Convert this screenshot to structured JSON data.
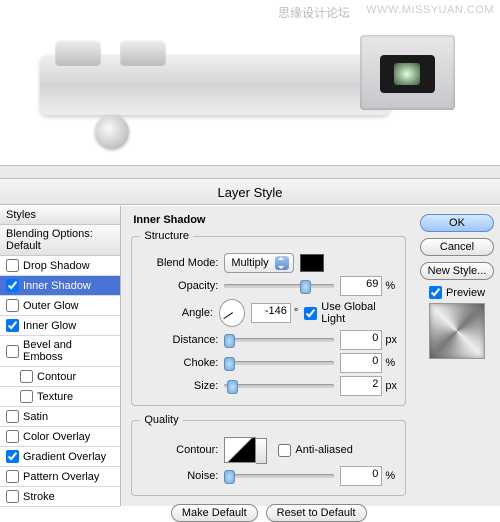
{
  "header": {
    "watermark_cn": "思缘设计论坛",
    "watermark_url": "WWW.MISSYUAN.COM"
  },
  "dialog": {
    "title": "Layer Style"
  },
  "left": {
    "styles_header": "Styles",
    "blending_header": "Blending Options: Default",
    "items": [
      "Drop Shadow",
      "Inner Shadow",
      "Outer Glow",
      "Inner Glow",
      "Bevel and Emboss",
      "Contour",
      "Texture",
      "Satin",
      "Color Overlay",
      "Gradient Overlay",
      "Pattern Overlay",
      "Stroke"
    ]
  },
  "mid": {
    "section": "Inner Shadow",
    "structure": "Structure",
    "blendmode_lbl": "Blend Mode:",
    "blendmode_val": "Multiply",
    "opacity_lbl": "Opacity:",
    "opacity_val": "69",
    "angle_lbl": "Angle:",
    "angle_val": "-146",
    "deg": "°",
    "global_light": "Use Global Light",
    "distance_lbl": "Distance:",
    "distance_val": "0",
    "choke_lbl": "Choke:",
    "choke_val": "0",
    "size_lbl": "Size:",
    "size_val": "2",
    "px": "px",
    "pct": "%",
    "quality": "Quality",
    "contour_lbl": "Contour:",
    "antialiased": "Anti-aliased",
    "noise_lbl": "Noise:",
    "noise_val": "0",
    "make_default": "Make Default",
    "reset_default": "Reset to Default"
  },
  "right": {
    "ok": "OK",
    "cancel": "Cancel",
    "new_style": "New Style...",
    "preview": "Preview"
  }
}
